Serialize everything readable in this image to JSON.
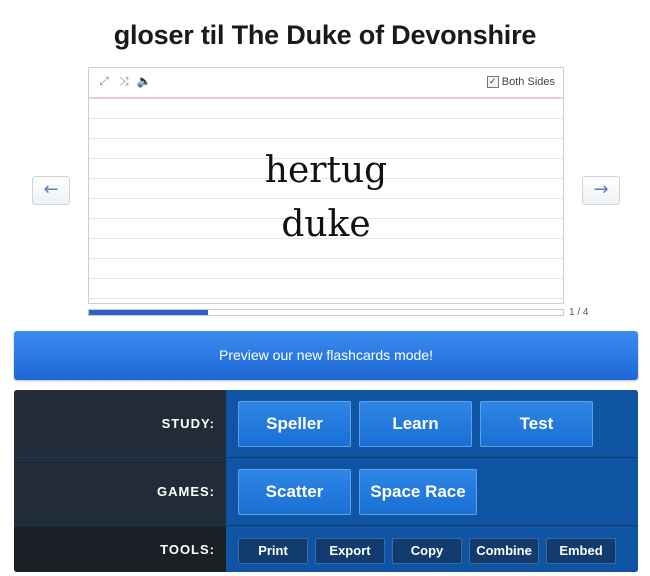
{
  "title": "gloser til The Duke of Devonshire",
  "card": {
    "front": "hertug",
    "back": "duke",
    "both_sides_label": "Both Sides",
    "both_sides_checked": true,
    "tools": [
      "expand-icon",
      "shuffle-icon",
      "speaker-icon"
    ]
  },
  "nav": {
    "prev": "←",
    "next": "→"
  },
  "progress": {
    "current": 1,
    "total": 4,
    "counter": "1 / 4",
    "fraction": 0.25
  },
  "banner": "Preview our new flashcards mode!",
  "study": {
    "label": "STUDY:",
    "buttons": [
      "Speller",
      "Learn",
      "Test"
    ]
  },
  "games": {
    "label": "GAMES:",
    "buttons": [
      "Scatter",
      "Space Race"
    ]
  },
  "tools": {
    "label": "TOOLS:",
    "buttons": [
      "Print",
      "Export",
      "Copy",
      "Combine",
      "Embed"
    ]
  },
  "colors": {
    "accent": "#1c66d6",
    "panel_dark": "#1f2a3a",
    "panel_blue": "#0f55a4"
  }
}
